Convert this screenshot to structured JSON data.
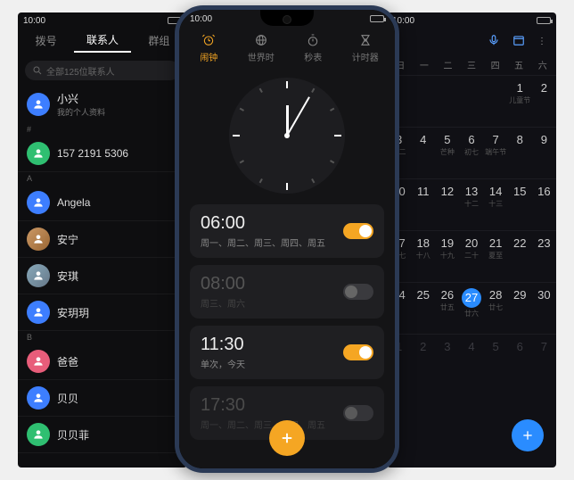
{
  "left": {
    "status_time": "10:00",
    "tabs": [
      "拨号",
      "联系人",
      "群组"
    ],
    "active_tab": 1,
    "search_placeholder": "全部125位联系人",
    "profile": {
      "name": "小兴",
      "sub": "我的个人资料"
    },
    "sections": [
      {
        "hdr": "#",
        "items": [
          {
            "name": "157 2191 5306",
            "avatar": "green"
          }
        ]
      },
      {
        "hdr": "A",
        "items": [
          {
            "name": "Angela",
            "avatar": "blue"
          },
          {
            "name": "安宁",
            "avatar": "img1"
          },
          {
            "name": "安琪",
            "avatar": "img2"
          },
          {
            "name": "安玥玥",
            "avatar": "blue"
          }
        ]
      },
      {
        "hdr": "B",
        "items": [
          {
            "name": "爸爸",
            "avatar": "pink"
          },
          {
            "name": "贝贝",
            "avatar": "blue"
          },
          {
            "name": "贝贝菲",
            "avatar": "green"
          }
        ]
      }
    ]
  },
  "center": {
    "status_time": "10:00",
    "tabs": [
      {
        "label": "闹钟",
        "icon": "alarm"
      },
      {
        "label": "世界时",
        "icon": "globe"
      },
      {
        "label": "秒表",
        "icon": "stopwatch"
      },
      {
        "label": "计时器",
        "icon": "timer"
      }
    ],
    "active_tab": 0,
    "alarms": [
      {
        "time": "06:00",
        "days": "周一、周二、周三、周四、周五",
        "on": true
      },
      {
        "time": "08:00",
        "days": "周三、周六",
        "on": false
      },
      {
        "time": "11:30",
        "days": "单次，今天",
        "on": true
      },
      {
        "time": "17:30",
        "days": "周一、周二、周三、周四、周五",
        "on": false
      }
    ]
  },
  "right": {
    "status_time": "10:00",
    "dow": [
      "日",
      "一",
      "二",
      "三",
      "四",
      "五",
      "六"
    ],
    "rows": [
      [
        {
          "d": "",
          "s": ""
        },
        {
          "d": "",
          "s": ""
        },
        {
          "d": "",
          "s": ""
        },
        {
          "d": "",
          "s": ""
        },
        {
          "d": "",
          "s": ""
        },
        {
          "d": "1",
          "s": "儿童节"
        },
        {
          "d": "2",
          "s": ""
        }
      ],
      [
        {
          "d": "3",
          "s": "初二"
        },
        {
          "d": "4",
          "s": ""
        },
        {
          "d": "5",
          "s": "芒种"
        },
        {
          "d": "6",
          "s": "初七"
        },
        {
          "d": "7",
          "s": "端午节"
        },
        {
          "d": "8",
          "s": ""
        },
        {
          "d": "9",
          "s": ""
        }
      ],
      [
        {
          "d": "10",
          "s": ""
        },
        {
          "d": "11",
          "s": ""
        },
        {
          "d": "12",
          "s": ""
        },
        {
          "d": "13",
          "s": "十二"
        },
        {
          "d": "14",
          "s": "十三"
        },
        {
          "d": "15",
          "s": ""
        },
        {
          "d": "16",
          "s": ""
        }
      ],
      [
        {
          "d": "17",
          "s": "十七"
        },
        {
          "d": "18",
          "s": "十八"
        },
        {
          "d": "19",
          "s": "十九"
        },
        {
          "d": "20",
          "s": "二十"
        },
        {
          "d": "21",
          "s": "夏至"
        },
        {
          "d": "22",
          "s": ""
        },
        {
          "d": "23",
          "s": ""
        }
      ],
      [
        {
          "d": "24",
          "s": ""
        },
        {
          "d": "25",
          "s": ""
        },
        {
          "d": "26",
          "s": "廿五"
        },
        {
          "d": "27",
          "s": "廿六",
          "today": true
        },
        {
          "d": "28",
          "s": "廿七"
        },
        {
          "d": "29",
          "s": ""
        },
        {
          "d": "30",
          "s": ""
        }
      ],
      [
        {
          "d": "1",
          "s": "",
          "dim": true
        },
        {
          "d": "2",
          "s": "",
          "dim": true
        },
        {
          "d": "3",
          "s": "",
          "dim": true
        },
        {
          "d": "4",
          "s": "",
          "dim": true
        },
        {
          "d": "5",
          "s": "",
          "dim": true
        },
        {
          "d": "6",
          "s": "",
          "dim": true
        },
        {
          "d": "7",
          "s": "",
          "dim": true
        }
      ]
    ]
  }
}
